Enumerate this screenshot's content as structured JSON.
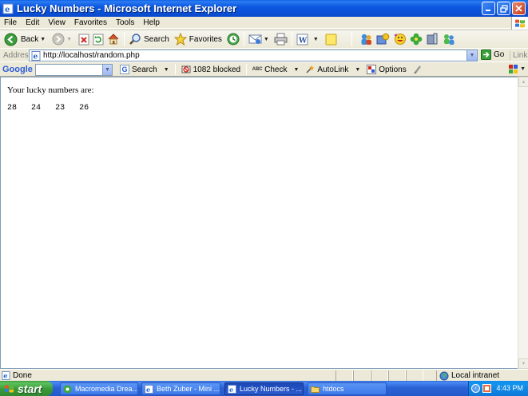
{
  "window": {
    "title": "Lucky Numbers - Microsoft Internet Explorer",
    "controls": [
      "minimize",
      "maximize",
      "close"
    ]
  },
  "menu": [
    "File",
    "Edit",
    "View",
    "Favorites",
    "Tools",
    "Help"
  ],
  "toolbar": {
    "back_label": "Back",
    "search_label": "Search",
    "favorites_label": "Favorites",
    "icons": [
      "back-icon",
      "forward-icon",
      "stop-icon",
      "refresh-icon",
      "home-icon",
      "search-icon",
      "favorites-icon",
      "history-icon",
      "mail-icon",
      "print-icon",
      "edit-icon",
      "discuss-icon",
      "messenger-icon",
      "media-icon",
      "flower-icon",
      "sound-icon",
      "friends-icon"
    ]
  },
  "address": {
    "label": "Address",
    "url": "http://localhost/random.php",
    "go_label": "Go",
    "links_label": "Links"
  },
  "google": {
    "logo": "Google",
    "search_label": "Search",
    "blocked_label": "1082 blocked",
    "check_label": "Check",
    "autolink_label": "AutoLink",
    "options_label": "Options"
  },
  "page": {
    "intro": "Your lucky numbers are:",
    "numbers": [
      "28",
      "24",
      "23",
      "26"
    ]
  },
  "status": {
    "text": "Done",
    "zone": "Local intranet"
  },
  "taskbar": {
    "start_label": "start",
    "tasks": [
      {
        "label": "Macromedia Drea...",
        "active": false
      },
      {
        "label": "Beth Zuber - Mini ...",
        "active": false
      },
      {
        "label": "Lucky Numbers - ...",
        "active": true
      },
      {
        "label": "htdocs",
        "active": false
      }
    ],
    "clock": "4:43 PM"
  }
}
